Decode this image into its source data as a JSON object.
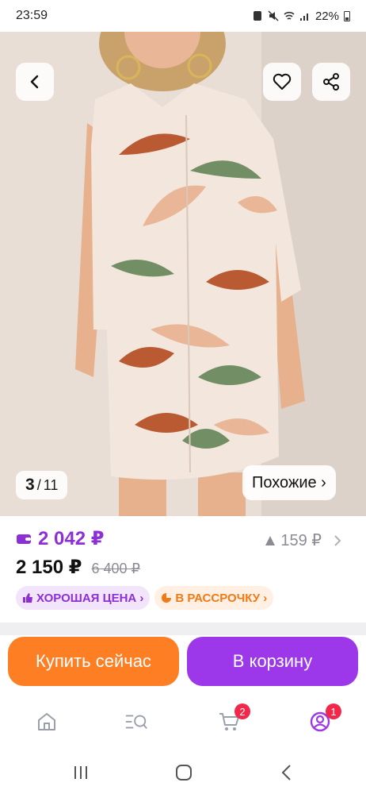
{
  "status_bar": {
    "time": "23:59",
    "battery": "22%"
  },
  "photo": {
    "counter_current": "3",
    "counter_sep": "/",
    "counter_total": "11",
    "similar_label": "Похожие ›"
  },
  "price": {
    "wallet_price": "2 042 ₽",
    "main_price": "2 150 ₽",
    "old_price": "6 400 ₽",
    "bonus": "159 ₽"
  },
  "badges": {
    "good_price": "ХОРОШАЯ ЦЕНА ›",
    "installment": "В РАССРОЧКУ ›"
  },
  "actions": {
    "buy_now": "Купить сейчас",
    "add_to_cart": "В корзину"
  },
  "bottom_nav": {
    "cart_count": "2",
    "profile_count": "1"
  },
  "colors": {
    "purple": "#9c38e9",
    "orange": "#fe7e24",
    "badge_red": "#f2284a"
  }
}
